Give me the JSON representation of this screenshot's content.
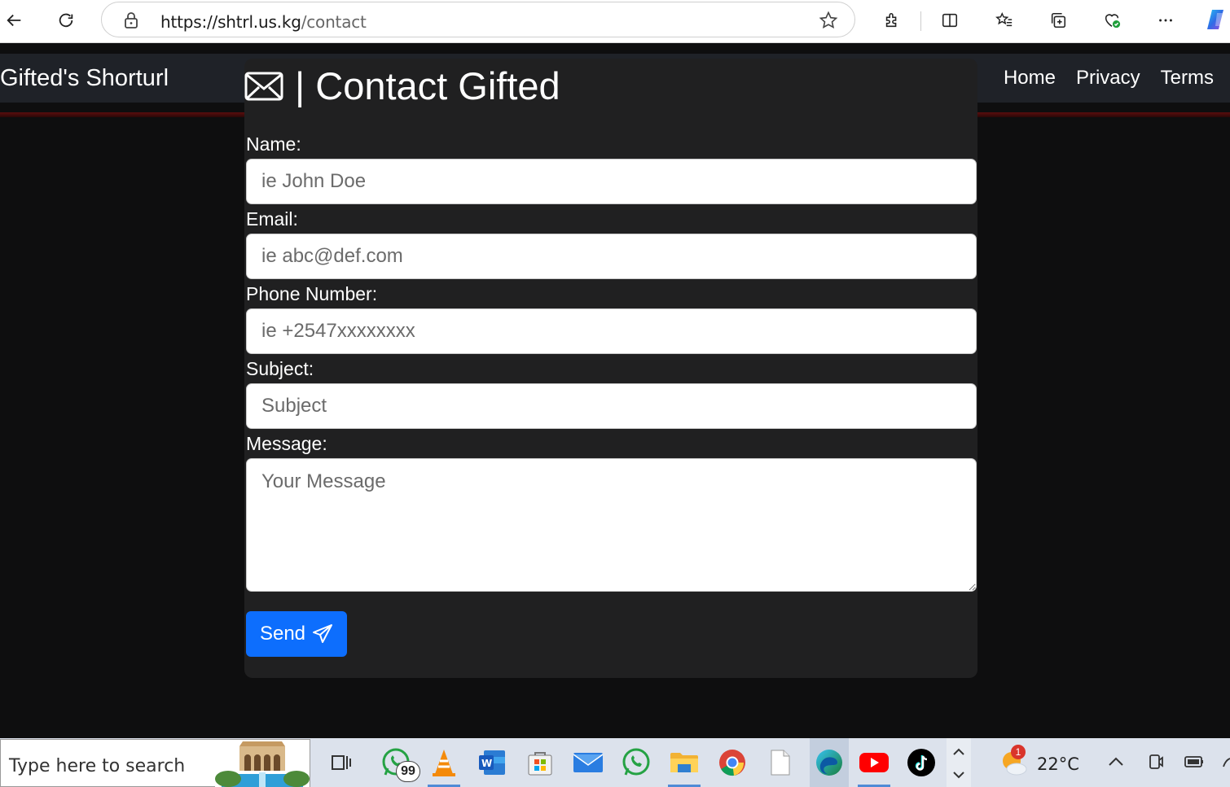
{
  "browser": {
    "url_host": "https://shtrl.us.kg",
    "url_path": "/contact"
  },
  "site": {
    "brand": "Gifted's Shorturl",
    "nav": [
      "Home",
      "Privacy",
      "Terms"
    ]
  },
  "contact_form": {
    "title": "| Contact Gifted",
    "fields": [
      {
        "label": "Name:",
        "placeholder": "ie John Doe"
      },
      {
        "label": "Email:",
        "placeholder": "ie abc@def.com"
      },
      {
        "label": "Phone Number:",
        "placeholder": "ie +2547xxxxxxxx"
      },
      {
        "label": "Subject:",
        "placeholder": "Subject"
      },
      {
        "label": "Message:",
        "placeholder": "Your Message"
      }
    ],
    "send_label": "Send"
  },
  "taskbar": {
    "search_placeholder": "Type here to search",
    "whatsapp_badge": "99",
    "weather_badge": "1",
    "temperature": "22°C"
  },
  "colors": {
    "page_bg": "#0e0e0f",
    "card_bg": "#202021",
    "nav_bg": "#1f2228",
    "accent": "#0d6efd"
  }
}
